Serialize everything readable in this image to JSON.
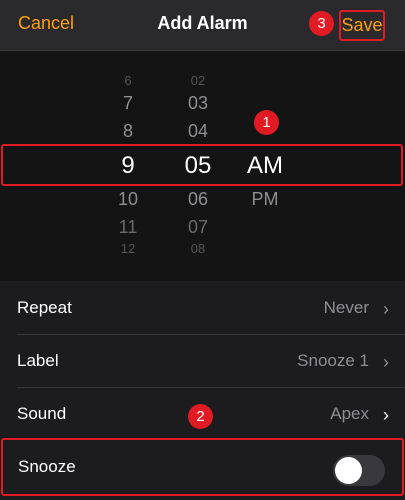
{
  "header": {
    "cancel_label": "Cancel",
    "title": "Add Alarm",
    "save_label": "Save"
  },
  "badges": {
    "save": "3",
    "picker": "1",
    "snooze": "2"
  },
  "picker": {
    "hours": [
      "6",
      "7",
      "8",
      "9",
      "10",
      "11",
      "12"
    ],
    "minutes": [
      "02",
      "03",
      "04",
      "05",
      "06",
      "07",
      "08"
    ],
    "periods": [
      "AM",
      "PM"
    ],
    "selected": {
      "hour": "9",
      "minute": "05",
      "period": "AM"
    }
  },
  "settings": [
    {
      "label": "Repeat",
      "value": "Never"
    },
    {
      "label": "Label",
      "value": "Snooze 1"
    },
    {
      "label": "Sound",
      "value": "Apex"
    }
  ],
  "snooze": {
    "label": "Snooze",
    "enabled": false
  },
  "colors": {
    "accent": "#ff9f0a",
    "highlight": "#e01b24",
    "background": "#1c1c1e"
  }
}
